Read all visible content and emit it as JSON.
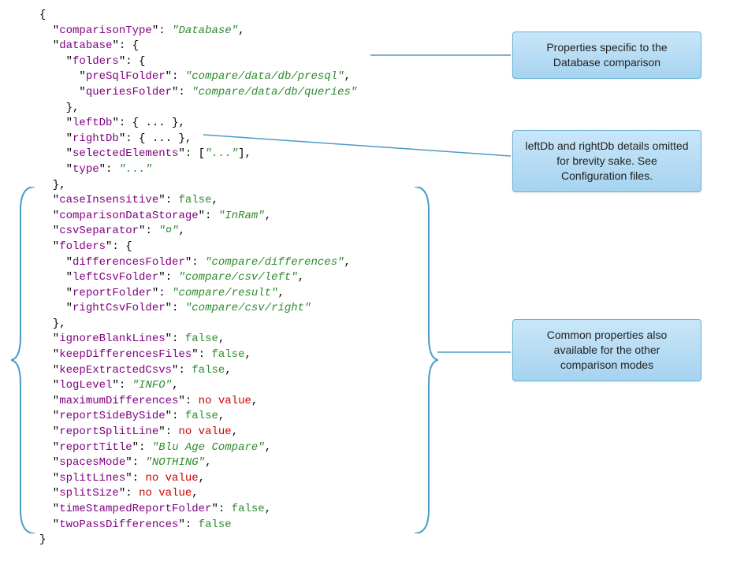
{
  "json_lines": [
    [
      {
        "t": "punct",
        "v": "{"
      }
    ],
    [
      {
        "t": "punct",
        "v": "  \""
      },
      {
        "t": "key",
        "v": "comparisonType"
      },
      {
        "t": "punct",
        "v": "\": "
      },
      {
        "t": "str",
        "v": "\"Database\""
      },
      {
        "t": "punct",
        "v": ","
      }
    ],
    [
      {
        "t": "punct",
        "v": "  \""
      },
      {
        "t": "key",
        "v": "database"
      },
      {
        "t": "punct",
        "v": "\": {"
      }
    ],
    [
      {
        "t": "punct",
        "v": "    \""
      },
      {
        "t": "key",
        "v": "folders"
      },
      {
        "t": "punct",
        "v": "\": {"
      }
    ],
    [
      {
        "t": "punct",
        "v": "      \""
      },
      {
        "t": "key",
        "v": "preSqlFolder"
      },
      {
        "t": "punct",
        "v": "\": "
      },
      {
        "t": "str",
        "v": "\"compare/data/db/presql\""
      },
      {
        "t": "punct",
        "v": ","
      }
    ],
    [
      {
        "t": "punct",
        "v": "      \""
      },
      {
        "t": "key",
        "v": "queriesFolder"
      },
      {
        "t": "punct",
        "v": "\": "
      },
      {
        "t": "str",
        "v": "\"compare/data/db/queries\""
      }
    ],
    [
      {
        "t": "punct",
        "v": "    },"
      }
    ],
    [
      {
        "t": "punct",
        "v": "    \""
      },
      {
        "t": "key",
        "v": "leftDb"
      },
      {
        "t": "punct",
        "v": "\": { ... },"
      }
    ],
    [
      {
        "t": "punct",
        "v": "    \""
      },
      {
        "t": "key",
        "v": "rightDb"
      },
      {
        "t": "punct",
        "v": "\": { ... },"
      }
    ],
    [
      {
        "t": "punct",
        "v": "    \""
      },
      {
        "t": "key",
        "v": "selectedElements"
      },
      {
        "t": "punct",
        "v": "\": ["
      },
      {
        "t": "str",
        "v": "\"...\""
      },
      {
        "t": "punct",
        "v": "],"
      }
    ],
    [
      {
        "t": "punct",
        "v": "    \""
      },
      {
        "t": "key",
        "v": "type"
      },
      {
        "t": "punct",
        "v": "\": "
      },
      {
        "t": "str",
        "v": "\"...\""
      }
    ],
    [
      {
        "t": "punct",
        "v": "  },"
      }
    ],
    [
      {
        "t": "punct",
        "v": "  \""
      },
      {
        "t": "key",
        "v": "caseInsensitive"
      },
      {
        "t": "punct",
        "v": "\": "
      },
      {
        "t": "bool",
        "v": "false"
      },
      {
        "t": "punct",
        "v": ","
      }
    ],
    [
      {
        "t": "punct",
        "v": "  \""
      },
      {
        "t": "key",
        "v": "comparisonDataStorage"
      },
      {
        "t": "punct",
        "v": "\": "
      },
      {
        "t": "str",
        "v": "\"InRam\""
      },
      {
        "t": "punct",
        "v": ","
      }
    ],
    [
      {
        "t": "punct",
        "v": "  \""
      },
      {
        "t": "key",
        "v": "csvSeparator"
      },
      {
        "t": "punct",
        "v": "\": "
      },
      {
        "t": "str",
        "v": "\"¤\""
      },
      {
        "t": "punct",
        "v": ","
      }
    ],
    [
      {
        "t": "punct",
        "v": "  \""
      },
      {
        "t": "key",
        "v": "folders"
      },
      {
        "t": "punct",
        "v": "\": {"
      }
    ],
    [
      {
        "t": "punct",
        "v": "    \""
      },
      {
        "t": "key",
        "v": "differencesFolder"
      },
      {
        "t": "punct",
        "v": "\": "
      },
      {
        "t": "str",
        "v": "\"compare/differences\""
      },
      {
        "t": "punct",
        "v": ","
      }
    ],
    [
      {
        "t": "punct",
        "v": "    \""
      },
      {
        "t": "key",
        "v": "leftCsvFolder"
      },
      {
        "t": "punct",
        "v": "\": "
      },
      {
        "t": "str",
        "v": "\"compare/csv/left\""
      },
      {
        "t": "punct",
        "v": ","
      }
    ],
    [
      {
        "t": "punct",
        "v": "    \""
      },
      {
        "t": "key",
        "v": "reportFolder"
      },
      {
        "t": "punct",
        "v": "\": "
      },
      {
        "t": "str",
        "v": "\"compare/result\""
      },
      {
        "t": "punct",
        "v": ","
      }
    ],
    [
      {
        "t": "punct",
        "v": "    \""
      },
      {
        "t": "key",
        "v": "rightCsvFolder"
      },
      {
        "t": "punct",
        "v": "\": "
      },
      {
        "t": "str",
        "v": "\"compare/csv/right\""
      }
    ],
    [
      {
        "t": "punct",
        "v": "  },"
      }
    ],
    [
      {
        "t": "punct",
        "v": "  \""
      },
      {
        "t": "key",
        "v": "ignoreBlankLines"
      },
      {
        "t": "punct",
        "v": "\": "
      },
      {
        "t": "bool",
        "v": "false"
      },
      {
        "t": "punct",
        "v": ","
      }
    ],
    [
      {
        "t": "punct",
        "v": "  \""
      },
      {
        "t": "key",
        "v": "keepDifferencesFiles"
      },
      {
        "t": "punct",
        "v": "\": "
      },
      {
        "t": "bool",
        "v": "false"
      },
      {
        "t": "punct",
        "v": ","
      }
    ],
    [
      {
        "t": "punct",
        "v": "  \""
      },
      {
        "t": "key",
        "v": "keepExtractedCsvs"
      },
      {
        "t": "punct",
        "v": "\": "
      },
      {
        "t": "bool",
        "v": "false"
      },
      {
        "t": "punct",
        "v": ","
      }
    ],
    [
      {
        "t": "punct",
        "v": "  \""
      },
      {
        "t": "key",
        "v": "logLevel"
      },
      {
        "t": "punct",
        "v": "\": "
      },
      {
        "t": "str",
        "v": "\"INFO\""
      },
      {
        "t": "punct",
        "v": ","
      }
    ],
    [
      {
        "t": "punct",
        "v": "  \""
      },
      {
        "t": "key",
        "v": "maximumDifferences"
      },
      {
        "t": "punct",
        "v": "\": "
      },
      {
        "t": "noval",
        "v": "no value"
      },
      {
        "t": "punct",
        "v": ","
      }
    ],
    [
      {
        "t": "punct",
        "v": "  \""
      },
      {
        "t": "key",
        "v": "reportSideBySide"
      },
      {
        "t": "punct",
        "v": "\": "
      },
      {
        "t": "bool",
        "v": "false"
      },
      {
        "t": "punct",
        "v": ","
      }
    ],
    [
      {
        "t": "punct",
        "v": "  \""
      },
      {
        "t": "key",
        "v": "reportSplitLine"
      },
      {
        "t": "punct",
        "v": "\": "
      },
      {
        "t": "noval",
        "v": "no value"
      },
      {
        "t": "punct",
        "v": ","
      }
    ],
    [
      {
        "t": "punct",
        "v": "  \""
      },
      {
        "t": "key",
        "v": "reportTitle"
      },
      {
        "t": "punct",
        "v": "\": "
      },
      {
        "t": "str",
        "v": "\"Blu Age Compare\""
      },
      {
        "t": "punct",
        "v": ","
      }
    ],
    [
      {
        "t": "punct",
        "v": "  \""
      },
      {
        "t": "key",
        "v": "spacesMode"
      },
      {
        "t": "punct",
        "v": "\": "
      },
      {
        "t": "str",
        "v": "\"NOTHING\""
      },
      {
        "t": "punct",
        "v": ","
      }
    ],
    [
      {
        "t": "punct",
        "v": "  \""
      },
      {
        "t": "key",
        "v": "splitLines"
      },
      {
        "t": "punct",
        "v": "\": "
      },
      {
        "t": "noval",
        "v": "no value"
      },
      {
        "t": "punct",
        "v": ","
      }
    ],
    [
      {
        "t": "punct",
        "v": "  \""
      },
      {
        "t": "key",
        "v": "splitSize"
      },
      {
        "t": "punct",
        "v": "\": "
      },
      {
        "t": "noval",
        "v": "no value"
      },
      {
        "t": "punct",
        "v": ","
      }
    ],
    [
      {
        "t": "punct",
        "v": "  \""
      },
      {
        "t": "key",
        "v": "timeStampedReportFolder"
      },
      {
        "t": "punct",
        "v": "\": "
      },
      {
        "t": "bool",
        "v": "false"
      },
      {
        "t": "punct",
        "v": ","
      }
    ],
    [
      {
        "t": "punct",
        "v": "  \""
      },
      {
        "t": "key",
        "v": "twoPassDifferences"
      },
      {
        "t": "punct",
        "v": "\": "
      },
      {
        "t": "bool",
        "v": "false"
      }
    ],
    [
      {
        "t": "punct",
        "v": "}"
      }
    ]
  ],
  "callouts": {
    "c1": "Properties specific to the Database comparison",
    "c2": "leftDb and rightDb details omitted for brevity sake. See Configuration files.",
    "c3": "Common properties also available for the other comparison modes"
  }
}
